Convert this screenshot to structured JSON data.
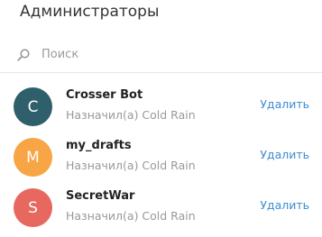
{
  "header": {
    "title": "Администраторы"
  },
  "search": {
    "placeholder": "Поиск"
  },
  "admins": [
    {
      "name": "Crosser Bot",
      "initial": "C",
      "subtitle": "Назначил(а) Cold Rain",
      "action": "Удалить",
      "avatar_color": "#2f5f6a"
    },
    {
      "name": "my_drafts",
      "initial": "M",
      "subtitle": "Назначил(а) Cold Rain",
      "action": "Удалить",
      "avatar_color": "#f7a545"
    },
    {
      "name": "SecretWar",
      "initial": "S",
      "subtitle": "Назначил(а) Cold Rain",
      "action": "Удалить",
      "avatar_color": "#e7685e"
    }
  ],
  "colors": {
    "link": "#3a8bd0"
  }
}
